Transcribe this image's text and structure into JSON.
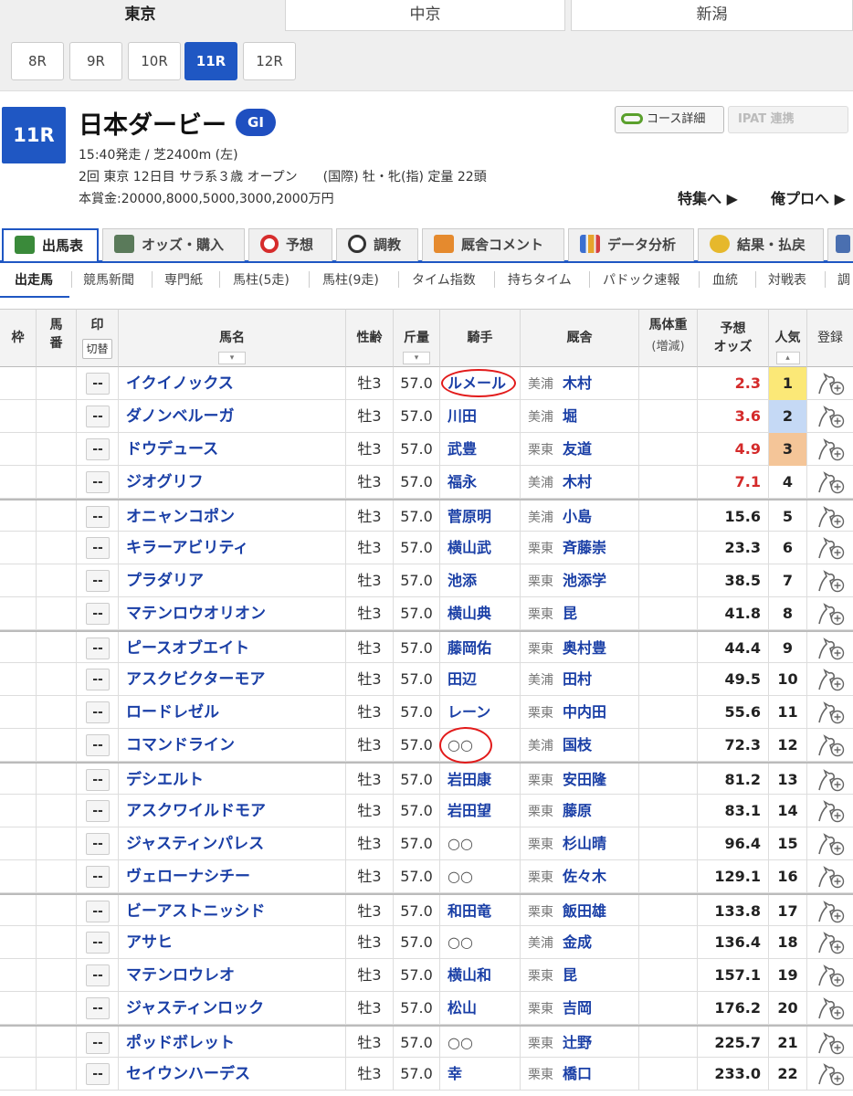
{
  "venues": [
    "東京",
    "中京",
    "新潟"
  ],
  "races": [
    "8R",
    "9R",
    "10R",
    "11R",
    "12R"
  ],
  "race": {
    "number": "11R",
    "name": "日本ダービー",
    "grade": "GI",
    "info1": "15:40発走 / 芝2400m (左)",
    "info2": "2回 東京 12日目 サラ系３歳 オープン　　(国際) 牡・牝(指) 定量 22頭",
    "info3": "本賞金:20000,8000,5000,3000,2000万円"
  },
  "buttons": {
    "course": "コース詳細",
    "ipat": "IPAT 連携"
  },
  "links": {
    "feature": "特集へ ▶",
    "pro": "俺プロへ ▶"
  },
  "main_tabs": [
    "出馬表",
    "オッズ・購入",
    "予想",
    "調教",
    "厩舎コメント",
    "データ分析",
    "結果・払戻"
  ],
  "sub_tabs": [
    "出走馬",
    "競馬新聞",
    "専門紙",
    "馬柱(5走)",
    "馬柱(9走)",
    "タイム指数",
    "持ちタイム",
    "パドック速報",
    "血統",
    "対戦表",
    "調"
  ],
  "headers": {
    "waku": "枠",
    "num1": "馬",
    "num2": "番",
    "mark": "印",
    "toggle": "切替",
    "horse": "馬名",
    "sexage": "性齢",
    "weight": "斤量",
    "jockey": "騎手",
    "stable": "厩舎",
    "bodyw1": "馬体重",
    "bodyw2": "(増減)",
    "odds1": "予想",
    "odds2": "オッズ",
    "pop": "人気",
    "reg": "登録"
  },
  "mark_label": "--",
  "accent": "#1f57c3",
  "runners": [
    {
      "horse": "イクイノックス",
      "sexage": "牡3",
      "weight": "57.0",
      "jockey": "ルメール",
      "region": "美浦",
      "trainer": "木村",
      "odds": "2.3",
      "pop": "1"
    },
    {
      "horse": "ダノンベルーガ",
      "sexage": "牡3",
      "weight": "57.0",
      "jockey": "川田",
      "region": "美浦",
      "trainer": "堀",
      "odds": "3.6",
      "pop": "2"
    },
    {
      "horse": "ドウデュース",
      "sexage": "牡3",
      "weight": "57.0",
      "jockey": "武豊",
      "region": "栗東",
      "trainer": "友道",
      "odds": "4.9",
      "pop": "3"
    },
    {
      "horse": "ジオグリフ",
      "sexage": "牡3",
      "weight": "57.0",
      "jockey": "福永",
      "region": "美浦",
      "trainer": "木村",
      "odds": "7.1",
      "pop": "4"
    },
    {
      "horse": "オニャンコポン",
      "sexage": "牡3",
      "weight": "57.0",
      "jockey": "菅原明",
      "region": "美浦",
      "trainer": "小島",
      "odds": "15.6",
      "pop": "5"
    },
    {
      "horse": "キラーアビリティ",
      "sexage": "牡3",
      "weight": "57.0",
      "jockey": "横山武",
      "region": "栗東",
      "trainer": "斉藤崇",
      "odds": "23.3",
      "pop": "6"
    },
    {
      "horse": "プラダリア",
      "sexage": "牡3",
      "weight": "57.0",
      "jockey": "池添",
      "region": "栗東",
      "trainer": "池添学",
      "odds": "38.5",
      "pop": "7"
    },
    {
      "horse": "マテンロウオリオン",
      "sexage": "牡3",
      "weight": "57.0",
      "jockey": "横山典",
      "region": "栗東",
      "trainer": "昆",
      "odds": "41.8",
      "pop": "8"
    },
    {
      "horse": "ピースオブエイト",
      "sexage": "牡3",
      "weight": "57.0",
      "jockey": "藤岡佑",
      "region": "栗東",
      "trainer": "奥村豊",
      "odds": "44.4",
      "pop": "9"
    },
    {
      "horse": "アスクビクターモア",
      "sexage": "牡3",
      "weight": "57.0",
      "jockey": "田辺",
      "region": "美浦",
      "trainer": "田村",
      "odds": "49.5",
      "pop": "10"
    },
    {
      "horse": "ロードレゼル",
      "sexage": "牡3",
      "weight": "57.0",
      "jockey": "レーン",
      "region": "栗東",
      "trainer": "中内田",
      "odds": "55.6",
      "pop": "11"
    },
    {
      "horse": "コマンドライン",
      "sexage": "牡3",
      "weight": "57.0",
      "jockey": "○○",
      "region": "美浦",
      "trainer": "国枝",
      "odds": "72.3",
      "pop": "12"
    },
    {
      "horse": "デシエルト",
      "sexage": "牡3",
      "weight": "57.0",
      "jockey": "岩田康",
      "region": "栗東",
      "trainer": "安田隆",
      "odds": "81.2",
      "pop": "13"
    },
    {
      "horse": "アスクワイルドモア",
      "sexage": "牡3",
      "weight": "57.0",
      "jockey": "岩田望",
      "region": "栗東",
      "trainer": "藤原",
      "odds": "83.1",
      "pop": "14"
    },
    {
      "horse": "ジャスティンパレス",
      "sexage": "牡3",
      "weight": "57.0",
      "jockey": "○○",
      "region": "栗東",
      "trainer": "杉山晴",
      "odds": "96.4",
      "pop": "15"
    },
    {
      "horse": "ヴェローナシチー",
      "sexage": "牡3",
      "weight": "57.0",
      "jockey": "○○",
      "region": "栗東",
      "trainer": "佐々木",
      "odds": "129.1",
      "pop": "16"
    },
    {
      "horse": "ビーアストニッシド",
      "sexage": "牡3",
      "weight": "57.0",
      "jockey": "和田竜",
      "region": "栗東",
      "trainer": "飯田雄",
      "odds": "133.8",
      "pop": "17"
    },
    {
      "horse": "アサヒ",
      "sexage": "牡3",
      "weight": "57.0",
      "jockey": "○○",
      "region": "美浦",
      "trainer": "金成",
      "odds": "136.4",
      "pop": "18"
    },
    {
      "horse": "マテンロウレオ",
      "sexage": "牡3",
      "weight": "57.0",
      "jockey": "横山和",
      "region": "栗東",
      "trainer": "昆",
      "odds": "157.1",
      "pop": "19"
    },
    {
      "horse": "ジャスティンロック",
      "sexage": "牡3",
      "weight": "57.0",
      "jockey": "松山",
      "region": "栗東",
      "trainer": "吉岡",
      "odds": "176.2",
      "pop": "20"
    },
    {
      "horse": "ポッドボレット",
      "sexage": "牡3",
      "weight": "57.0",
      "jockey": "○○",
      "region": "栗東",
      "trainer": "辻野",
      "odds": "225.7",
      "pop": "21"
    },
    {
      "horse": "セイウンハーデス",
      "sexage": "牡3",
      "weight": "57.0",
      "jockey": "幸",
      "region": "栗東",
      "trainer": "橋口",
      "odds": "233.0",
      "pop": "22"
    }
  ]
}
